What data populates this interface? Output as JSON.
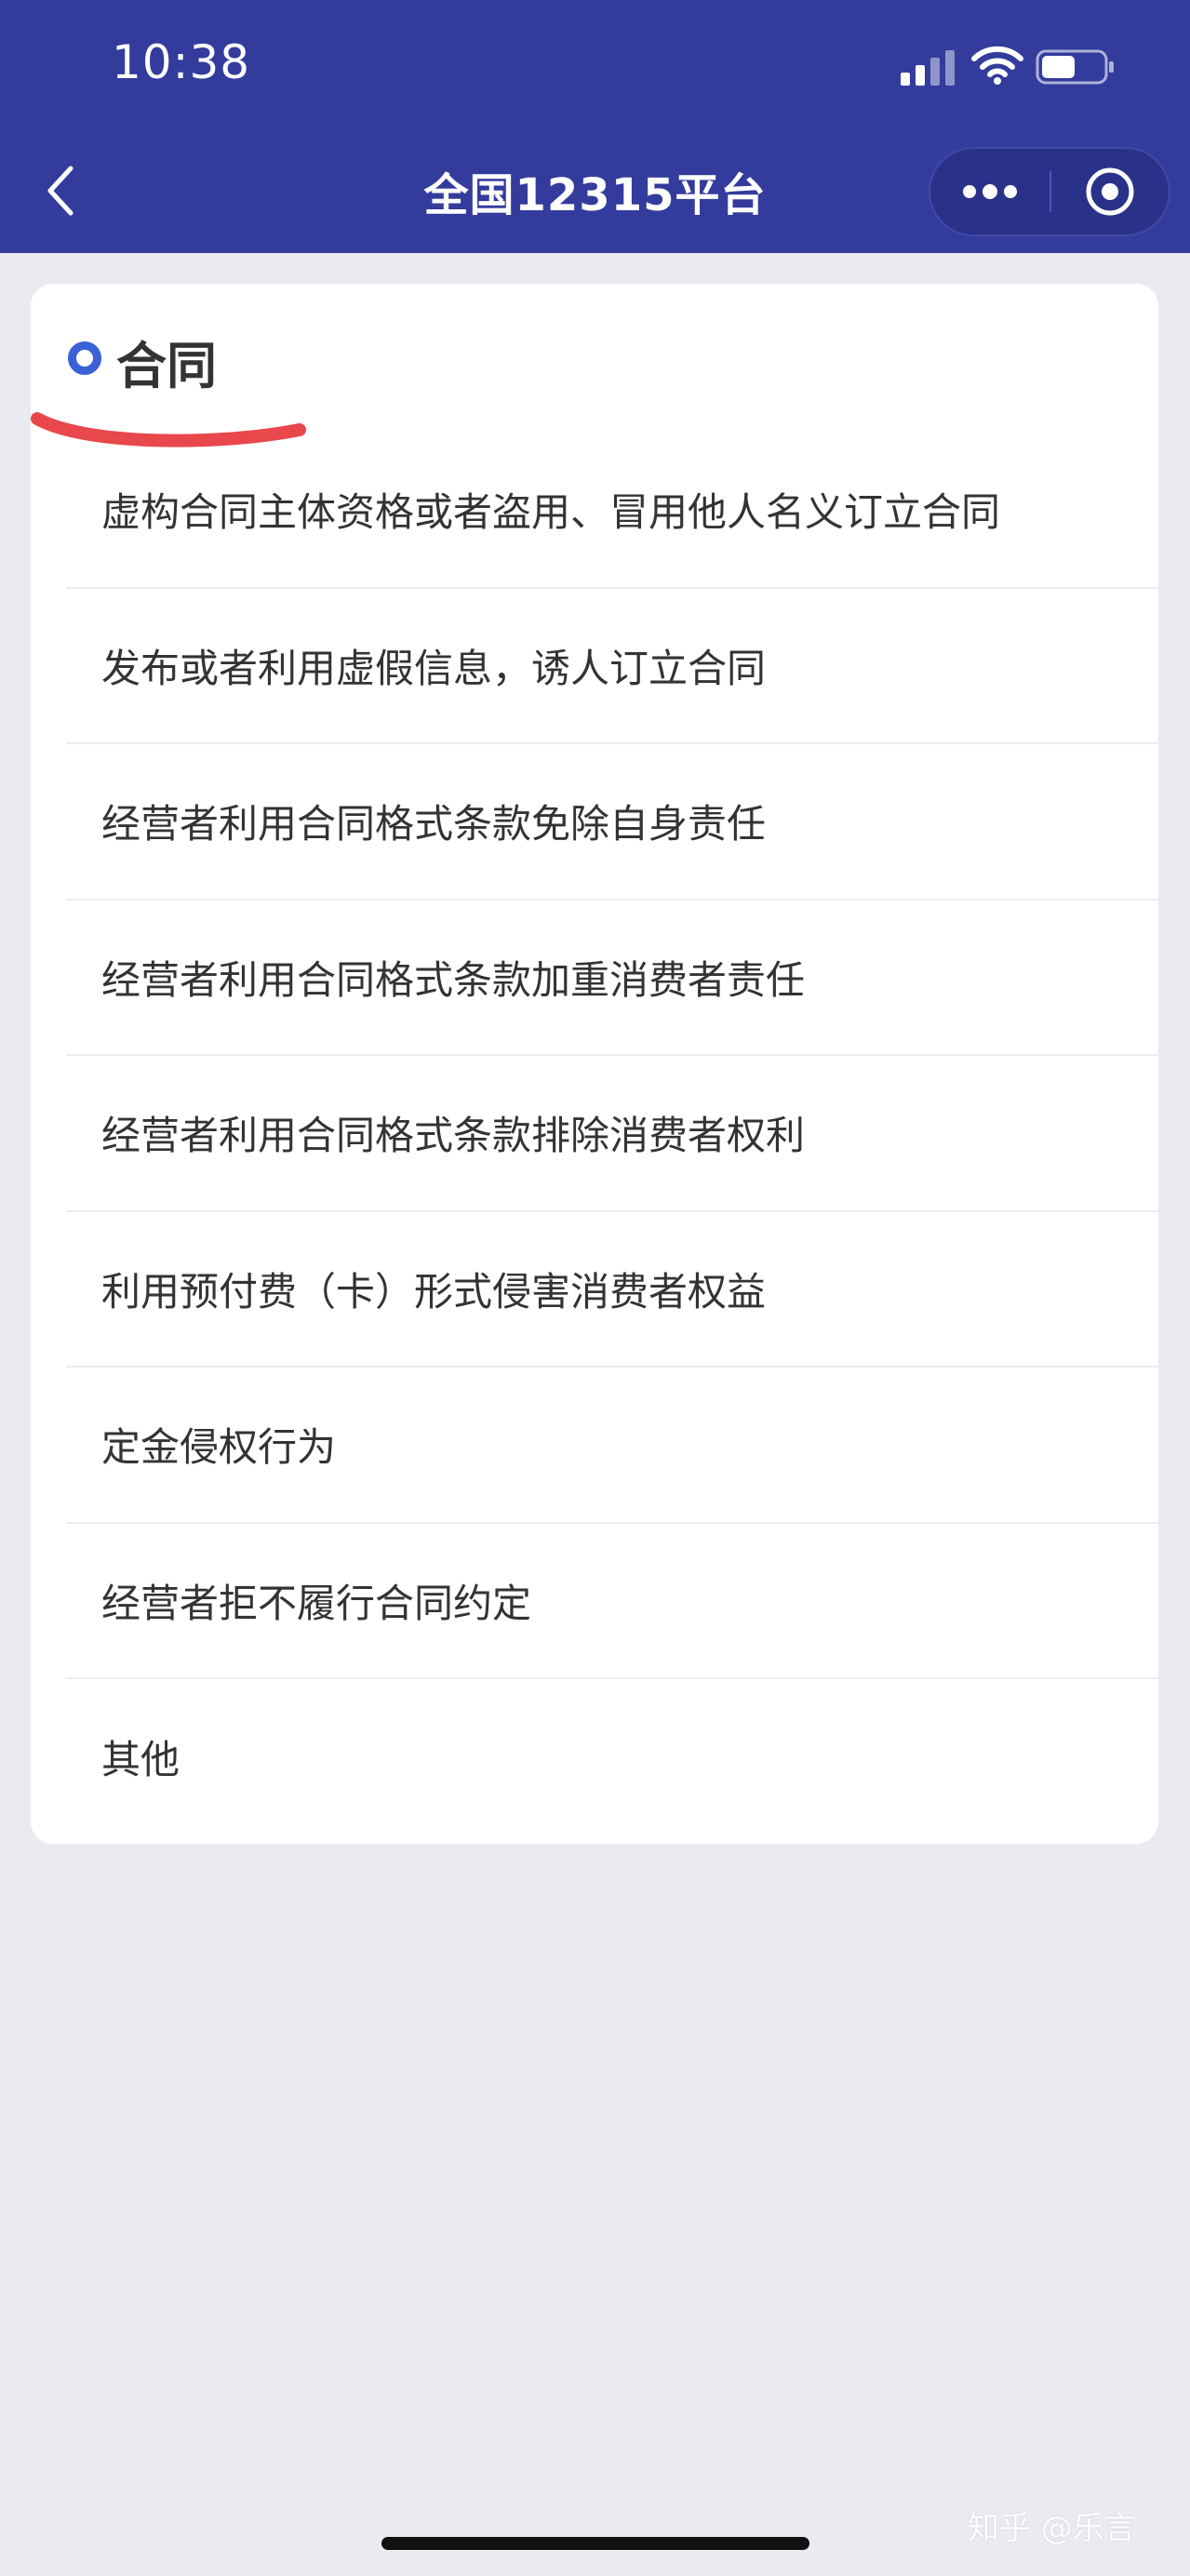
{
  "status_bar": {
    "time": "10:38",
    "signal_icon": "cellular-signal-icon",
    "wifi_icon": "wifi-icon",
    "battery_icon": "battery-icon",
    "battery_level": 0.55
  },
  "nav": {
    "title": "全国12315平台",
    "back_icon": "chevron-left-icon",
    "more_icon": "more-dots-icon",
    "close_icon": "target-circle-icon"
  },
  "section": {
    "title": "合同",
    "bullet_color": "#3a62d6",
    "annotation_color": "#e8474c"
  },
  "items": [
    {
      "label": "虚构合同主体资格或者盗用、冒用他人名义订立合同"
    },
    {
      "label": "发布或者利用虚假信息，诱人订立合同"
    },
    {
      "label": "经营者利用合同格式条款免除自身责任"
    },
    {
      "label": "经营者利用合同格式条款加重消费者责任"
    },
    {
      "label": "经营者利用合同格式条款排除消费者权利"
    },
    {
      "label": "利用预付费（卡）形式侵害消费者权益"
    },
    {
      "label": "定金侵权行为"
    },
    {
      "label": "经营者拒不履行合同约定"
    },
    {
      "label": "其他"
    }
  ],
  "watermark": "知乎 @乐言",
  "colors": {
    "header_bg": "#333c9c",
    "page_bg": "#e9ebf0",
    "card_bg": "#ffffff",
    "text": "#333333"
  }
}
